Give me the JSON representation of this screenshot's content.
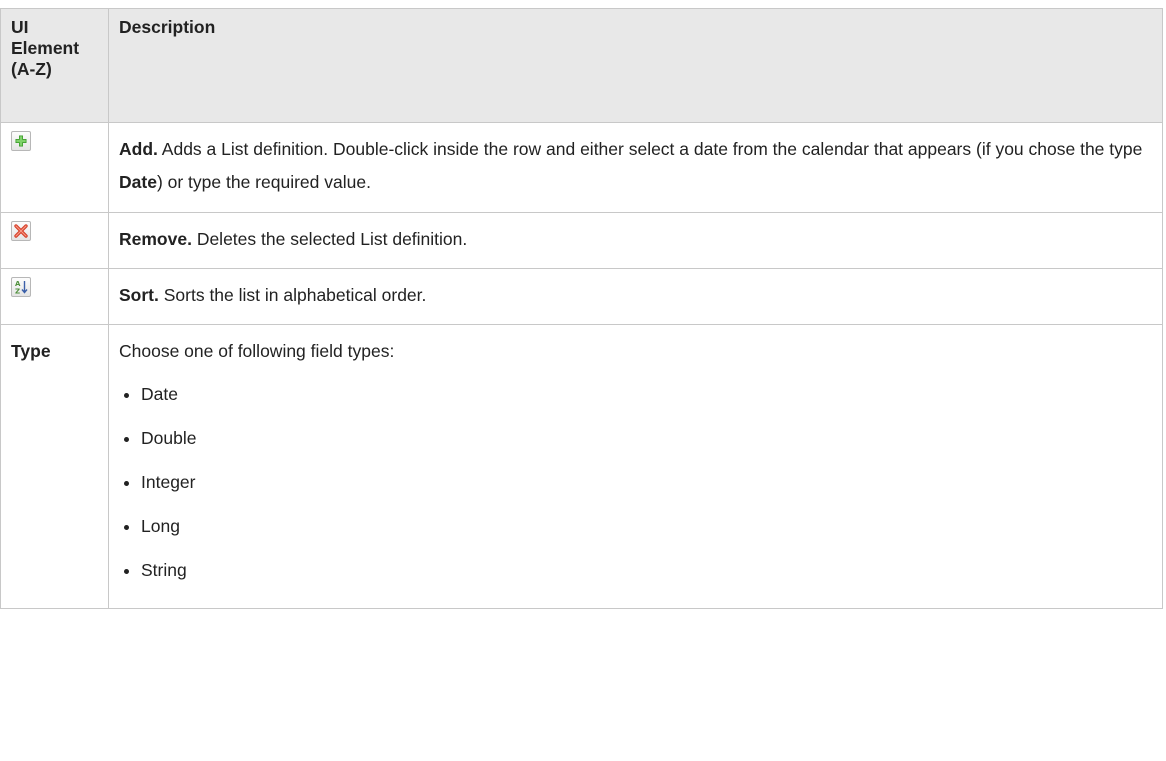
{
  "table": {
    "header": {
      "col1_line1": "UI",
      "col1_line2": "Element",
      "col1_line3": "(A-Z)",
      "col2": "Description"
    },
    "rows": [
      {
        "icon": "add-icon",
        "title": "Add.",
        "text_a": " Adds a List definition. Double-click inside the row and either select a date from the calendar that appears (if you chose the type ",
        "bold_b": "Date",
        "text_c": ") or type the required value."
      },
      {
        "icon": "remove-icon",
        "title": "Remove.",
        "text_a": " Deletes the selected List definition."
      },
      {
        "icon": "sort-az-icon",
        "title": "Sort.",
        "text_a": " Sorts the list in alphabetical order."
      },
      {
        "element": "Type",
        "intro": "Choose one of following field types:",
        "options": [
          "Date",
          "Double",
          "Integer",
          "Long",
          "String"
        ]
      }
    ]
  },
  "colors": {
    "header_bg": "#e8e8e8",
    "border": "#c8c8c8",
    "add_green": "#3a9a2a",
    "remove_red": "#d6402a",
    "sort_green": "#4e8f3a"
  }
}
